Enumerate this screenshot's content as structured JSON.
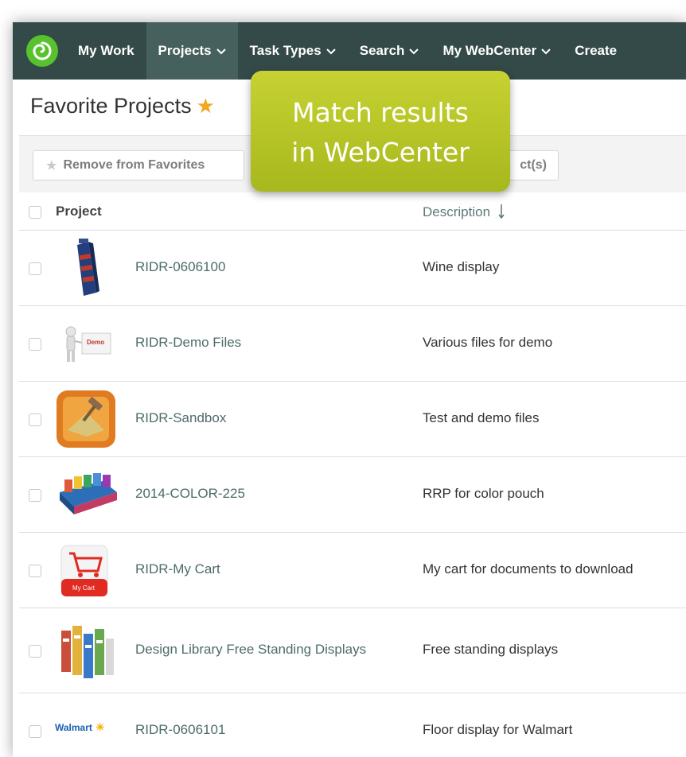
{
  "nav": {
    "items": [
      {
        "label": "My Work",
        "dropdown": false
      },
      {
        "label": "Projects",
        "dropdown": true
      },
      {
        "label": "Task Types",
        "dropdown": true
      },
      {
        "label": "Search",
        "dropdown": true
      },
      {
        "label": "My WebCenter",
        "dropdown": true
      },
      {
        "label": "Create",
        "dropdown": false
      }
    ],
    "active": "Projects",
    "logo_icon": "webcenter-logo-icon",
    "colors": {
      "bar": "#344a48",
      "active": "#46605d",
      "logo": "#58c22e"
    }
  },
  "page": {
    "title": "Favorite Projects",
    "star_icon": "favorite-star-icon",
    "star_color": "#f2a71e"
  },
  "toolbar": {
    "remove_label": "Remove from Favorites",
    "second_button_visible": "ct(s)"
  },
  "table": {
    "headers": {
      "project": "Project",
      "description": "Description"
    },
    "sort_icon": "sort-down-icon",
    "rows": [
      {
        "project": "RIDR-0606100",
        "description": "Wine display",
        "thumb": "wine-display-thumb"
      },
      {
        "project": "RIDR-Demo Files",
        "description": "Various files for demo",
        "thumb": "demo-figure-thumb",
        "thumb_text": "Demo"
      },
      {
        "project": "RIDR-Sandbox",
        "description": "Test and demo files",
        "thumb": "sandbox-app-thumb"
      },
      {
        "project": "2014-COLOR-225",
        "description": "RRP for color pouch",
        "thumb": "color-pouch-thumb"
      },
      {
        "project": "RIDR-My Cart",
        "description": "My cart for documents to download",
        "thumb": "my-cart-thumb",
        "thumb_text": "My Cart"
      },
      {
        "project": "Design Library Free Standing Displays",
        "description": "Free standing displays",
        "thumb": "standing-displays-thumb"
      },
      {
        "project": "RIDR-0606101",
        "description": "Floor display for Walmart",
        "thumb": "walmart-logo-thumb",
        "thumb_text": "Walmart"
      }
    ]
  },
  "callout": {
    "line1": "Match results",
    "line2": "in WebCenter",
    "color": "#b5c426"
  }
}
